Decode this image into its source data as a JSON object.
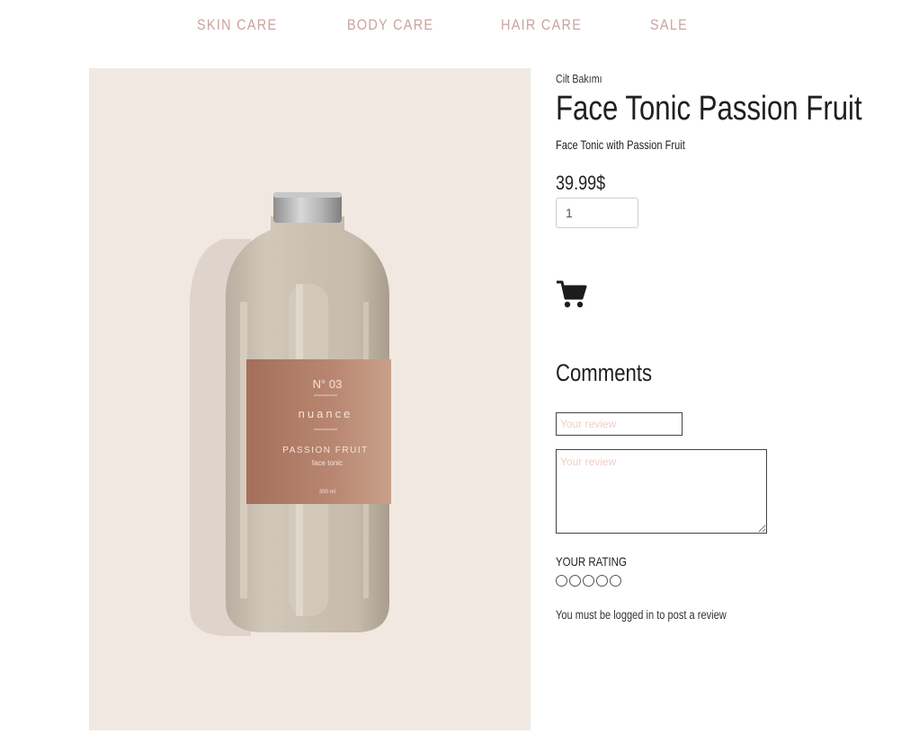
{
  "nav": {
    "items": [
      {
        "label": "SKIN CARE"
      },
      {
        "label": "BODY CARE"
      },
      {
        "label": "HAIR CARE"
      },
      {
        "label": "SALE"
      }
    ],
    "color": "#c9a3a0"
  },
  "product": {
    "image": {
      "background": "#f1e8e2",
      "label_number": "N° 03",
      "label_brand": "nuance",
      "label_name": "PASSION FRUIT",
      "label_type": "face tonic",
      "label_volume": "300 ml"
    },
    "category": "Cilt Bakımı",
    "title": "Face Tonic Passion Fruit",
    "subtitle": "Face Tonic with Passion Fruit",
    "price": "39.99$",
    "quantity": "1",
    "cart_icon": "shopping-cart-icon"
  },
  "comments": {
    "heading": "Comments",
    "name_placeholder": "Your review",
    "review_placeholder": "Your review",
    "rating_label": "YOUR RATING",
    "star_count": 5,
    "login_note": "You must be logged in to post a review"
  }
}
